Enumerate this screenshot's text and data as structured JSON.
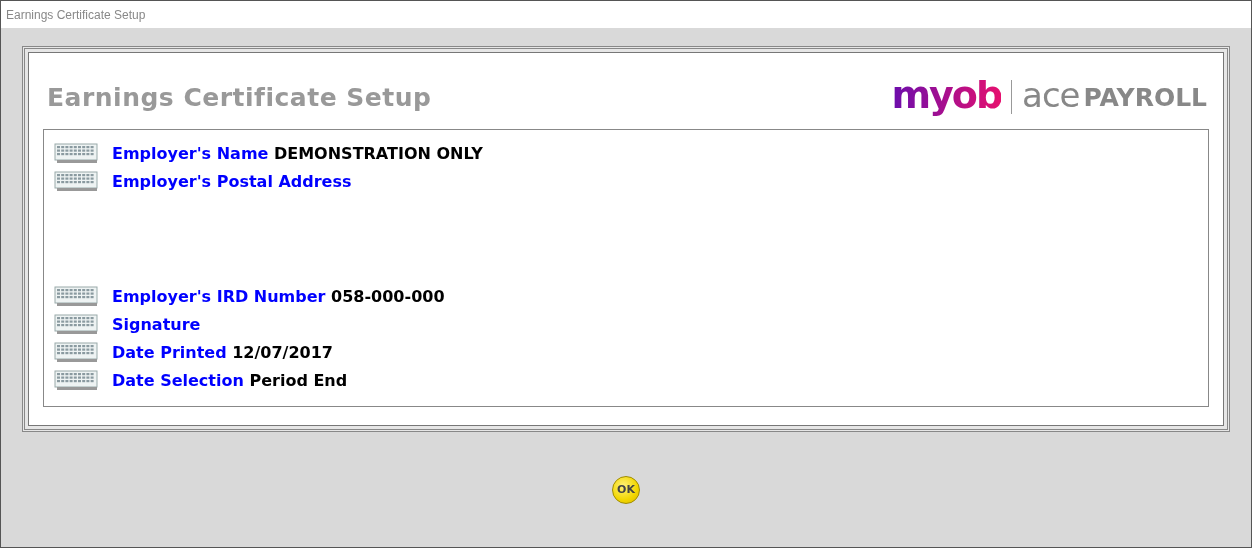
{
  "window": {
    "title": "Earnings Certificate Setup"
  },
  "header": {
    "title": "Earnings Certificate Setup",
    "logo": {
      "brand": "myob",
      "product": "ace",
      "product_suffix": "PAYROLL"
    }
  },
  "fields": [
    {
      "kind": "line",
      "label": "Employer's Name",
      "value": "DEMONSTRATION ONLY"
    },
    {
      "kind": "address",
      "label": "Employer's Postal Address"
    },
    {
      "kind": "line",
      "label": "Employer's IRD Number",
      "value": "058-000-000"
    },
    {
      "kind": "line",
      "label": "Signature"
    },
    {
      "kind": "line",
      "label": "Date Printed",
      "value": "12/07/2017"
    },
    {
      "kind": "line",
      "label": "Date Selection",
      "value": "Period End"
    }
  ],
  "ok_button": "OK"
}
